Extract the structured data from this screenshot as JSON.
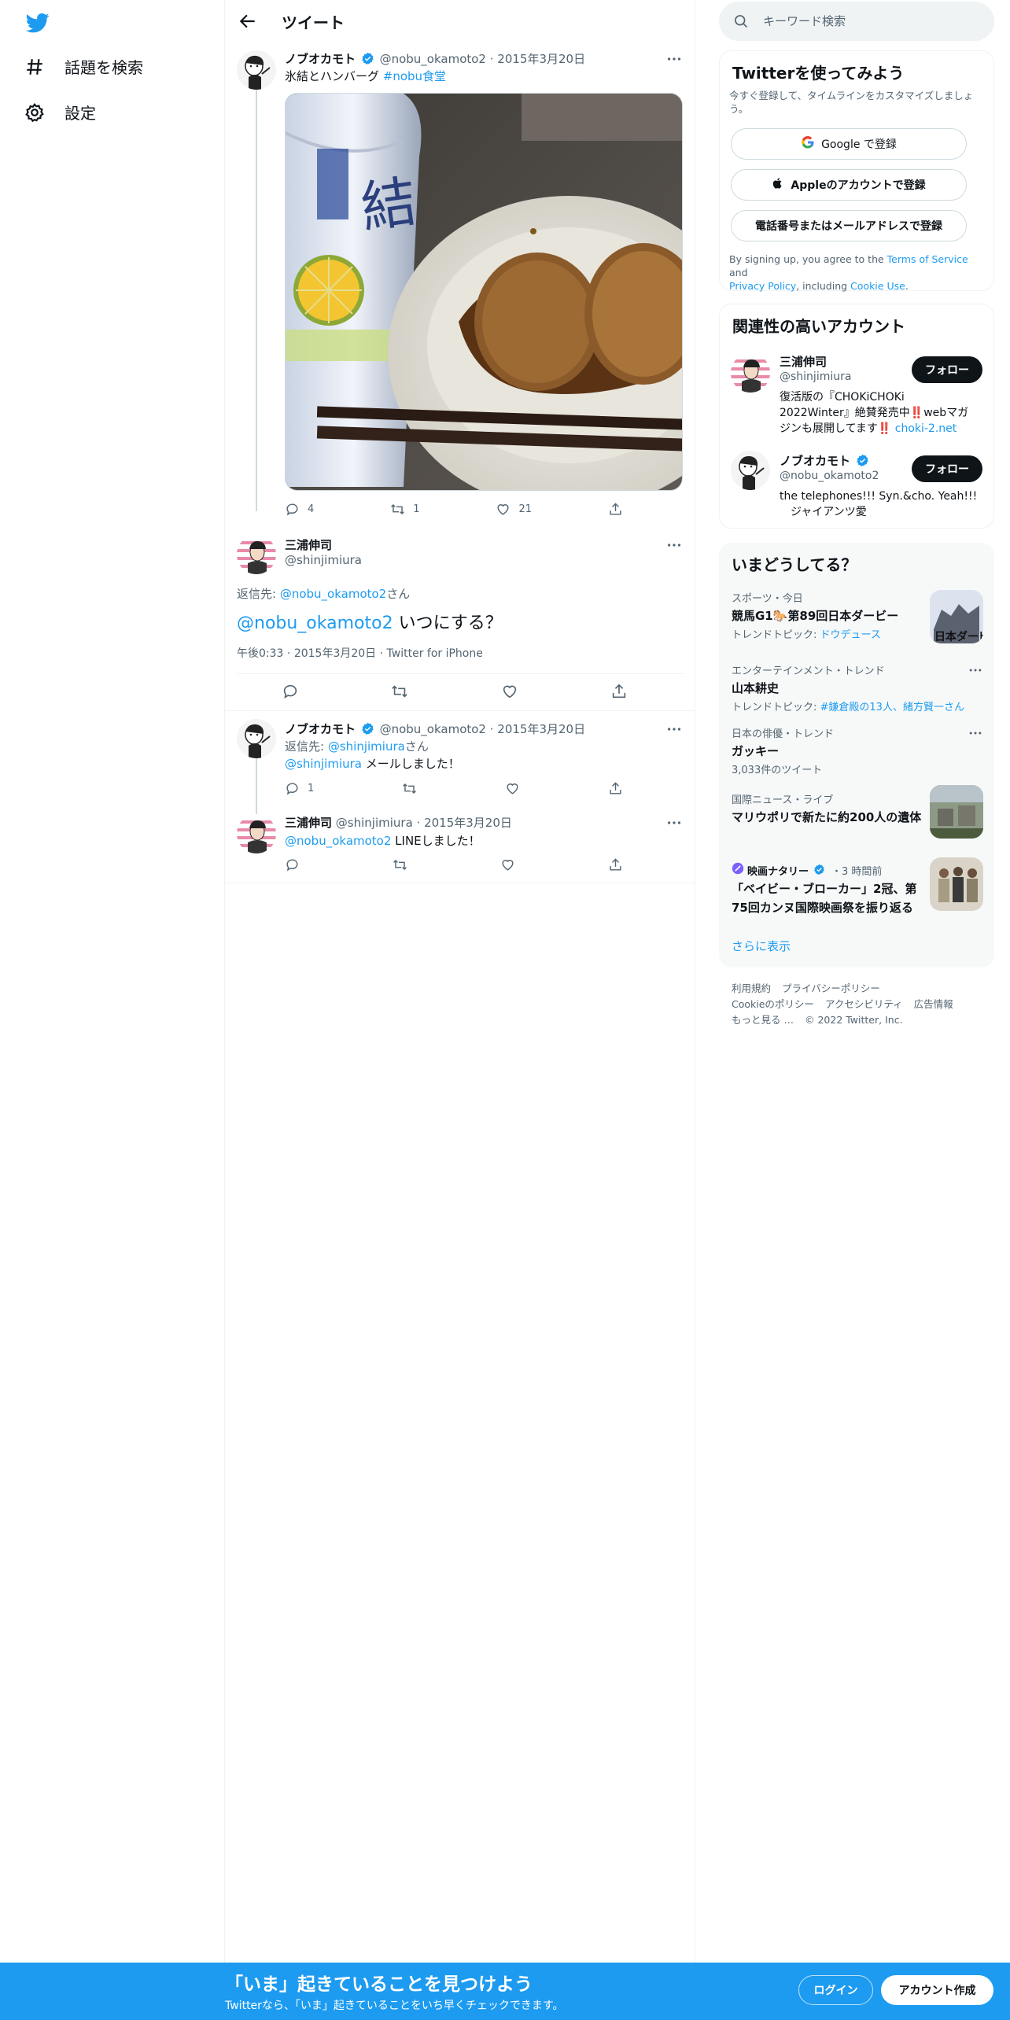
{
  "nav": {
    "explore_label": "話題を検索",
    "settings_label": "設定"
  },
  "main": {
    "header_title": "ツイート",
    "tweet1": {
      "name": "ノブオカモト",
      "handle": "@nobu_okamoto2",
      "date": "2015年3月20日",
      "text": "氷結とハンバーグ ",
      "hashtag": "#nobu食堂",
      "replies": "4",
      "retweets": "1",
      "likes": "21"
    },
    "focus": {
      "name": "三浦伸司",
      "handle": "@shinjimiura",
      "reply_prefix": "返信先: ",
      "reply_to": "@nobu_okamoto2",
      "reply_suffix": "さん",
      "mention": "@nobu_okamoto2",
      "text": " いつにする？",
      "time": "午後0:33",
      "date": "2015年3月20日",
      "source": "Twitter for iPhone"
    },
    "tweet3": {
      "name": "ノブオカモト",
      "handle": "@nobu_okamoto2",
      "date": "2015年3月20日",
      "reply_prefix": "返信先: ",
      "reply_to": "@shinjimiura",
      "reply_suffix": "さん",
      "mention": "@shinjimiura",
      "text": " メールしました！",
      "replies": "1"
    },
    "tweet4": {
      "name": "三浦伸司",
      "handle": "@shinjimiura",
      "date": "2015年3月20日",
      "mention": "@nobu_okamoto2",
      "text": " LINEしました！"
    }
  },
  "right": {
    "search_placeholder": "キーワード検索",
    "signup": {
      "title": "Twitterを使ってみよう",
      "subtitle": "今すぐ登録して、タイムラインをカスタマイズしましょう。",
      "google_label": "Google で登録",
      "apple_label": "Appleのアカウントで登録",
      "phone_label": "電話番号またはメールアドレスで登録",
      "terms_prefix": "By signing up, you agree to the ",
      "terms_link": "Terms of Service",
      "terms_and": " and",
      "privacy_link": "Privacy Policy",
      "including": ", including ",
      "cookie_link": "Cookie Use",
      "period": "."
    },
    "relevant": {
      "title": "関連性の高いアカウント",
      "follow_label": "フォロー",
      "accounts": [
        {
          "name": "三浦伸司",
          "handle": "@shinjimiura",
          "bio_line1": "復活版の『CHOKiCHOKi",
          "bio_line2": "2022Winter』絶賛発売中‼️webマガ",
          "bio_line3": "ジンも展開してます‼️ ",
          "bio_link": "choki-2.net"
        },
        {
          "name": "ノブオカモト",
          "handle": "@nobu_okamoto2",
          "bio_line1": "the telephones!!! Syn.&cho. Yeah!!!",
          "bio_line2": "　ジャイアンツ愛"
        }
      ]
    },
    "trends": {
      "title": "いまどうしてる？",
      "items": [
        {
          "meta": "スポーツ・今日",
          "title": "競馬G1🐎第89回日本ダービー",
          "sub_prefix": "トレンドトピック: ",
          "sub_link": "ドウデュース"
        },
        {
          "meta": "エンターテインメント・トレンド",
          "title": "山本耕史",
          "sub_prefix": "トレンドトピック: ",
          "sub_link": "#鎌倉殿の13人、緒方賢一さん"
        },
        {
          "meta": "日本の俳優・トレンド",
          "title": "ガッキー",
          "sub": "3,033件のツイート"
        },
        {
          "meta": "国際ニュース・ライブ",
          "title": "マリウポリで新たに約200人の遺体"
        },
        {
          "meta_name": "映画ナタリー",
          "meta_time": "・3 時間前",
          "title_line1": "「ベイビー・ブローカー」2冠、第",
          "title_line2": "75回カンヌ国際映画祭を振り返る"
        }
      ],
      "show_more": "さらに表示"
    },
    "footer": {
      "line1": [
        "利用規約",
        "プライバシーポリシー"
      ],
      "line2": [
        "Cookieのポリシー",
        "アクセシビリティ",
        "広告情報"
      ],
      "more": "もっと見る …",
      "copyright": "© 2022 Twitter, Inc."
    }
  },
  "bottom_bar": {
    "title": "「いま」起きていることを見つけよう",
    "subtitle": "Twitterなら、「いま」起きていることをいち早くチェックできます。",
    "login_label": "ログイン",
    "signup_label": "アカウント作成"
  },
  "colors": {
    "accent": "#1d9bf0",
    "text": "#0f1419",
    "muted": "#536471"
  }
}
